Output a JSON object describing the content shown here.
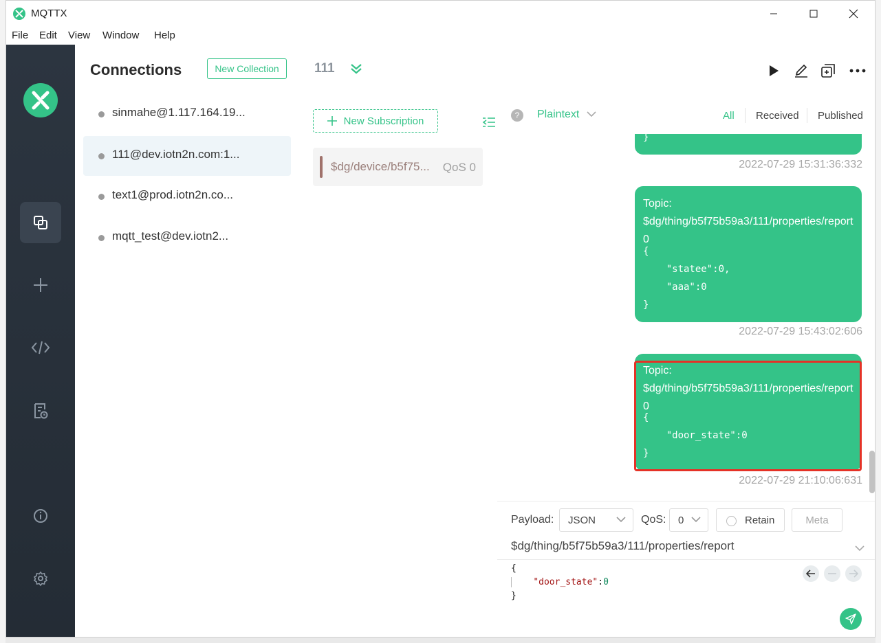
{
  "app": {
    "title": "MQTTX",
    "menu": [
      "File",
      "Edit",
      "View",
      "Window",
      "Help"
    ]
  },
  "connections": {
    "title": "Connections",
    "new_collection": "New Collection",
    "items": [
      {
        "label": "sinmahe@1.117.164.19..."
      },
      {
        "label": "111@dev.iotn2n.com:1..."
      },
      {
        "label": "text1@prod.iotn2n.co..."
      },
      {
        "label": "mqtt_test@dev.iotn2..."
      }
    ]
  },
  "header": {
    "connection_name": "111"
  },
  "subscriptions": {
    "new_subscription": "New Subscription",
    "items": [
      {
        "topic": "$dg/device/b5f75...",
        "qos": "QoS 0"
      }
    ]
  },
  "messages_toolbar": {
    "format": "Plaintext",
    "filters": [
      "All",
      "Received",
      "Published"
    ],
    "active_filter": "All"
  },
  "messages": [
    {
      "code": "}",
      "time": "2022-07-29 15:31:36:332"
    },
    {
      "topic": "Topic: $dg/thing/b5f75b59a3/111/properties/report",
      "qos": "QoS: 0",
      "code": "{\n    \"statee\":0,\n    \"aaa\":0\n}",
      "time": "2022-07-29 15:43:02:606"
    },
    {
      "topic": "Topic: $dg/thing/b5f75b59a3/111/properties/report",
      "qos": "QoS: 0",
      "code": "{\n    \"door_state\":0\n}",
      "time": "2022-07-29 21:10:06:631"
    }
  ],
  "publish": {
    "payload_label": "Payload:",
    "payload_format": "JSON",
    "qos_label": "QoS:",
    "qos_value": "0",
    "retain_label": "Retain",
    "meta_label": "Meta",
    "topic": "$dg/thing/b5f75b59a3/111/properties/report",
    "payload_open": "{",
    "payload_key": "\"door_state\"",
    "payload_colon": ":",
    "payload_value": "0",
    "payload_close": "}"
  },
  "colors": {
    "accent": "#34c388",
    "highlight": "#e53226",
    "nav_bg": "#2c3540"
  }
}
